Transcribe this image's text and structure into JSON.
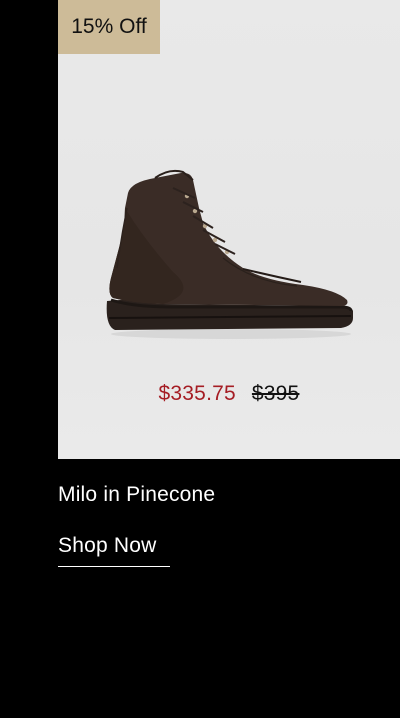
{
  "badge": {
    "label": "15% Off"
  },
  "product": {
    "image_icon": "boot-image",
    "sale_price": "$335.75",
    "original_price": "$395",
    "name": "Milo in Pinecone"
  },
  "cta": {
    "label": "Shop Now"
  },
  "colors": {
    "badge_bg": "#cdbb98",
    "sale_price": "#a51d24",
    "page_bg": "#000000",
    "card_bg": "#e8e8e8"
  }
}
